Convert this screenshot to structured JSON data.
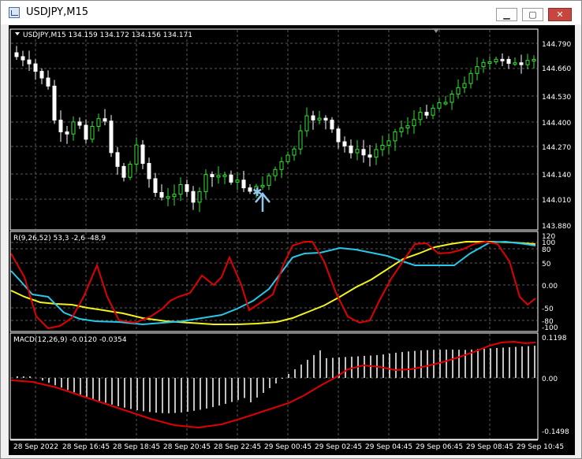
{
  "window": {
    "title": "USDJPY,M15",
    "buttons": {
      "minimize": "▁",
      "maximize": "▢",
      "close": "✕"
    }
  },
  "chart": {
    "header": "USDJPY,M15  134.159 134.172 134.156 134.171",
    "price_labels": [
      "144.790",
      "144.660",
      "144.530",
      "144.400",
      "144.270",
      "144.140",
      "144.010",
      "143.880"
    ],
    "time_labels": [
      "28 Sep 2022",
      "28 Sep 16:45",
      "28 Sep 18:45",
      "28 Sep 20:45",
      "28 Sep 22:45",
      "29 Sep 00:45",
      "29 Sep 02:45",
      "29 Sep 04:45",
      "29 Sep 06:45",
      "29 Sep 08:45",
      "29 Sep 10:45"
    ],
    "colors": {
      "background": "#000000",
      "up": "#33e233",
      "down": "#ffffff",
      "grid": "#606060",
      "arrow": "#8fc8ee"
    },
    "price_range": [
      143.88,
      144.79
    ]
  },
  "indicator1": {
    "label": "R(9,26,52) 53,3 -2,6 -48,9",
    "scale": [
      "120",
      "100",
      "80",
      "50",
      "0.00",
      "-50",
      "-80",
      "-100"
    ],
    "colors": {
      "fast": "#e00000",
      "mid": "#27c8e8",
      "slow": "#f2f21e"
    }
  },
  "macd": {
    "label": "MACD(12,26,9) -0.0120 -0.0354",
    "scale": [
      "0.1198",
      "0.00",
      "-0.1498"
    ],
    "colors": {
      "hist": "#c0c0c0",
      "signal": "#e00000"
    }
  }
}
